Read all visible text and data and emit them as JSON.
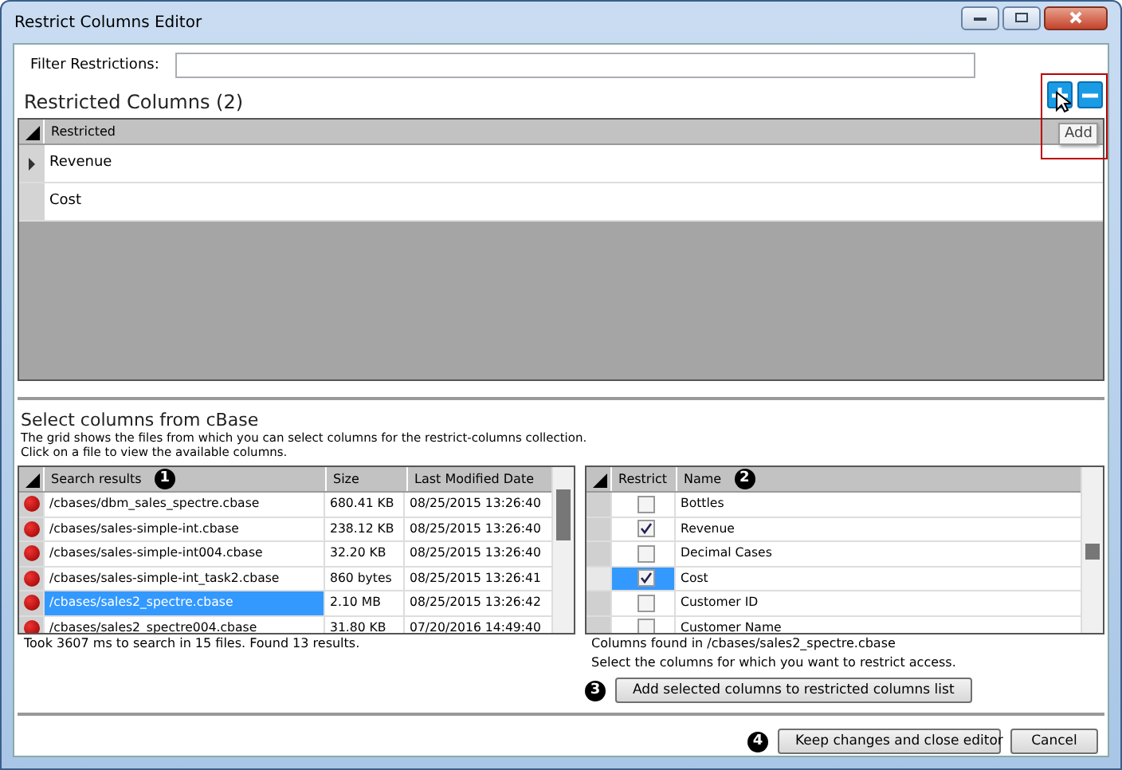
{
  "window": {
    "title": "Restrict Columns Editor"
  },
  "filter": {
    "label": "Filter Restrictions:"
  },
  "restricted": {
    "title": "Restricted Columns (2)",
    "tooltip": "Add",
    "column": "Restricted",
    "rows": [
      {
        "name": "Revenue",
        "selected": true
      },
      {
        "name": "Cost",
        "selected": false
      }
    ]
  },
  "cbase": {
    "title": "Select columns from cBase",
    "description": [
      "The grid shows the files from which you can select columns for the restrict-columns collection.",
      "Click on a file to view the available columns."
    ],
    "files": {
      "columns": [
        "Search results",
        "Size",
        "Last Modified Date"
      ],
      "badge": "1",
      "rows": [
        {
          "path": "/cbases/dbm_sales_spectre.cbase",
          "size": "680.41 KB",
          "date": "08/25/2015 13:26:40",
          "selected": false
        },
        {
          "path": "/cbases/sales-simple-int.cbase",
          "size": "238.12 KB",
          "date": "08/25/2015 13:26:40",
          "selected": false
        },
        {
          "path": "/cbases/sales-simple-int004.cbase",
          "size": "32.20 KB",
          "date": "08/25/2015 13:26:40",
          "selected": false
        },
        {
          "path": "/cbases/sales-simple-int_task2.cbase",
          "size": "860 bytes",
          "date": "08/25/2015 13:26:41",
          "selected": false
        },
        {
          "path": "/cbases/sales2_spectre.cbase",
          "size": "2.10 MB",
          "date": "08/25/2015 13:26:42",
          "selected": true
        },
        {
          "path": "/cbases/sales2_spectre004.cbase",
          "size": "31.80 KB",
          "date": "07/20/2016 14:49:40",
          "selected": false
        }
      ]
    },
    "status": "Took 3607 ms to search in 15 files. Found 13 results.",
    "columns": {
      "headers": [
        "Restrict",
        "Name"
      ],
      "badge": "2",
      "rows": [
        {
          "name": "Bottles",
          "checked": false,
          "selected": false
        },
        {
          "name": "Revenue",
          "checked": true,
          "selected": false
        },
        {
          "name": "Decimal Cases",
          "checked": false,
          "selected": false
        },
        {
          "name": "Cost",
          "checked": true,
          "selected": true
        },
        {
          "name": "Customer ID",
          "checked": false,
          "selected": false
        },
        {
          "name": "Customer Name",
          "checked": false,
          "selected": false
        }
      ]
    },
    "found": "Columns found in /cbases/sales2_spectre.cbase",
    "hint": "Select the columns for which you want to restrict access.",
    "add_button": {
      "badge": "3",
      "label": "Add selected columns to restricted columns list"
    }
  },
  "footer": {
    "badge": "4",
    "keep": "Keep changes and close editor",
    "cancel": "Cancel"
  }
}
